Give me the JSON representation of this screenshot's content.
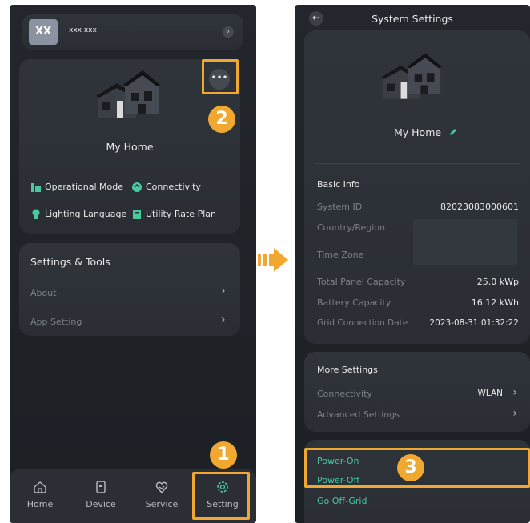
{
  "left": {
    "user": {
      "avatar_text": "XX",
      "name": "xxx xxx"
    },
    "home_card": {
      "name": "My Home",
      "quick_links": [
        "Operational Mode",
        "Connectivity",
        "Lighting Language",
        "Utility Rate Plan"
      ]
    },
    "settings_tools": {
      "title": "Settings & Tools",
      "items": [
        "About",
        "App Setting"
      ]
    },
    "nav": [
      "Home",
      "Device",
      "Service",
      "Setting"
    ]
  },
  "right": {
    "header": {
      "title": "System Settings"
    },
    "home_name": "My Home",
    "basic_info": {
      "title": "Basic Info",
      "rows": [
        {
          "label": "System ID",
          "value": "82023083000601"
        },
        {
          "label": "Country/Region",
          "value": ""
        },
        {
          "label": "Time Zone",
          "value": ""
        },
        {
          "label": "Total Panel Capacity",
          "value": "25.0 kWp"
        },
        {
          "label": "Battery Capacity",
          "value": "16.12 kWh"
        },
        {
          "label": "Grid Connection Date",
          "value": "2023-08-31 01:32:22"
        }
      ]
    },
    "more_settings": {
      "title": "More Settings",
      "rows": [
        {
          "label": "Connectivity",
          "value": "WLAN"
        },
        {
          "label": "Advanced Settings",
          "value": ""
        }
      ]
    },
    "power": [
      "Power-On",
      "Power-Off",
      "Go Off-Grid"
    ]
  },
  "steps": [
    "1",
    "2",
    "3"
  ],
  "colors": {
    "accent": "#48c9a0",
    "highlight": "#f0a830",
    "bg": "#1f2328"
  }
}
